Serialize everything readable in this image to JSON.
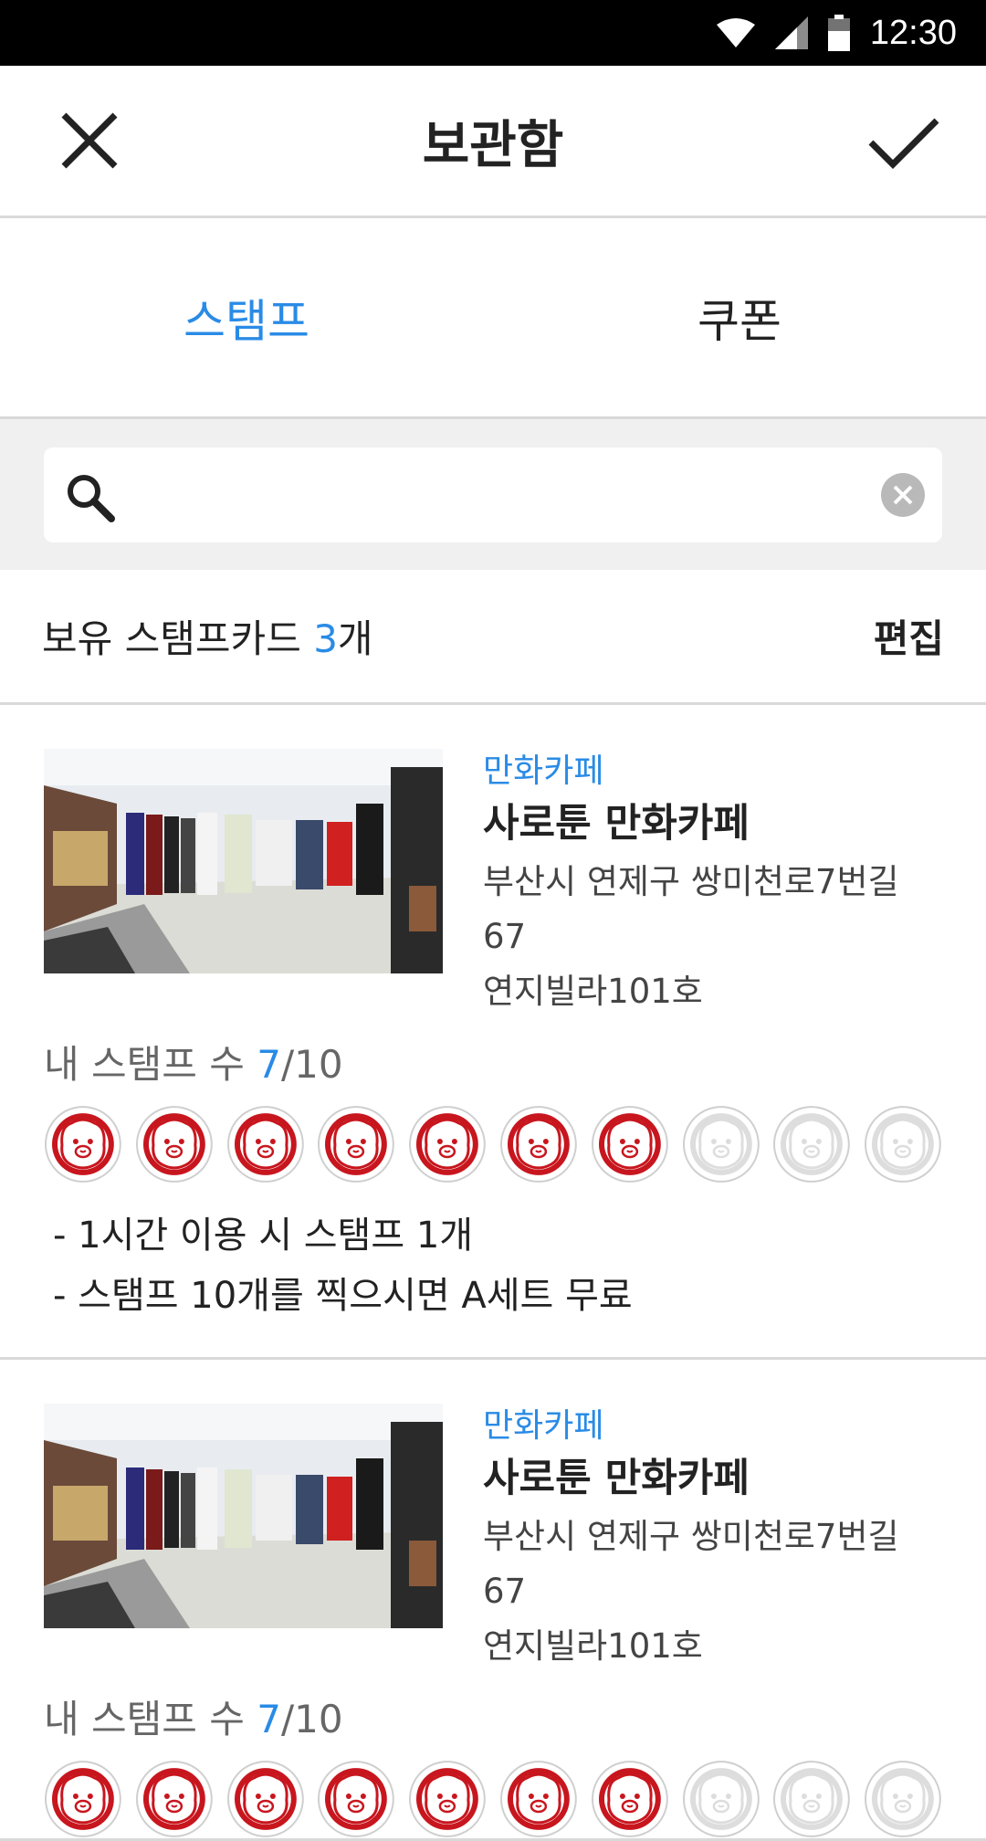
{
  "status": {
    "time": "12:30"
  },
  "header": {
    "title": "보관함"
  },
  "tabs": [
    {
      "label": "스탬프",
      "active": true
    },
    {
      "label": "쿠폰",
      "active": false
    }
  ],
  "search": {
    "value": "",
    "placeholder": ""
  },
  "summary": {
    "prefix": "보유 스탬프카드 ",
    "count": "3",
    "suffix": "개",
    "edit_label": "편집"
  },
  "cards": [
    {
      "category": "만화카페",
      "name": "사로툰 만화카페",
      "address1": "부산시 연제구 쌍미천로7번길 67",
      "address2": "연지빌라101호",
      "stamp_prefix": "내 스탬프 수 ",
      "stamp_current": "7",
      "stamp_total": "/10",
      "stamps_filled": 7,
      "stamps_total": 10,
      "desc": [
        "- 1시간 이용 시 스탬프 1개",
        "- 스탬프 10개를 찍으시면 A세트 무료"
      ]
    },
    {
      "category": "만화카페",
      "name": "사로툰 만화카페",
      "address1": "부산시 연제구 쌍미천로7번길 67",
      "address2": "연지빌라101호",
      "stamp_prefix": "내 스탬프 수 ",
      "stamp_current": "7",
      "stamp_total": "/10",
      "stamps_filled": 7,
      "stamps_total": 10,
      "desc": []
    }
  ],
  "colors": {
    "accent": "#2a8be6",
    "stamp_red": "#c8161e",
    "stamp_empty": "#dddddd"
  }
}
